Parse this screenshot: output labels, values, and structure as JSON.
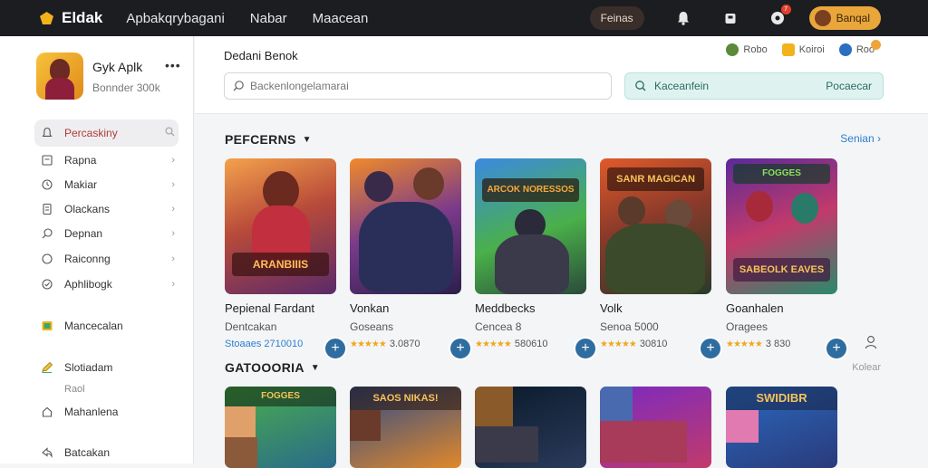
{
  "topbar": {
    "logo_text": "Eldak",
    "nav": [
      "Apbakqrybagani",
      "Nabar",
      "Maacean"
    ],
    "pill": "Feinas",
    "notif_count": "7",
    "user_label": "Banqal"
  },
  "sidebar": {
    "app_name": "Gyk Aplk",
    "app_sub": "Bonnder 300k",
    "items": [
      {
        "label": "Percaskiny"
      },
      {
        "label": "Rapna"
      },
      {
        "label": "Makiar"
      },
      {
        "label": "Olackans"
      },
      {
        "label": "Depnan"
      },
      {
        "label": "Raiconng"
      },
      {
        "label": "Aphlibogk"
      },
      {
        "label": "Mancecalan"
      },
      {
        "label": "Slotiadam"
      },
      {
        "label": "Mahanlena"
      },
      {
        "label": "Batcakan"
      }
    ],
    "sub_label": "Raol"
  },
  "header": {
    "title": "Dedani Benok",
    "badges": [
      "Robo",
      "Koiroi",
      "Roo"
    ],
    "search_placeholder": "Backenlongelamarai",
    "search2_left": "Kaceanfein",
    "search2_right": "Pocaecar"
  },
  "sections": {
    "featured_title": "PEFCERNS",
    "featured_link": "Senian",
    "category_title": "GATOOORIA",
    "category_link": "Kolear"
  },
  "cards": [
    {
      "name": "Pepienal Fardant",
      "sub": "Dentcakan",
      "rating": "Stoaaes 2710010",
      "stars": false
    },
    {
      "name": "Vonkan",
      "sub": "Goseans",
      "rating": "3.0870",
      "stars": true
    },
    {
      "name": "Meddbecks",
      "sub": "Cencea 8",
      "rating": "580610",
      "stars": true
    },
    {
      "name": "Volk",
      "sub": "Senoa 5000",
      "rating": "30810",
      "stars": true
    },
    {
      "name": "Goanhalen",
      "sub": "Oragees",
      "rating": "3 830",
      "stars": true
    }
  ],
  "art_text": [
    "ARANBIIIS",
    "ARCOK NORESSOS",
    "SANR MAGICAN",
    "SABEOLK EAVES",
    "FOGGES",
    "SAOS NIKAS!",
    "SWIDIBR"
  ],
  "colors": {
    "topbar_bg": "#1b1d21",
    "accent_orange": "#e9a63a",
    "link_blue": "#2a7fd0",
    "plus_button": "#2f6da0",
    "search2_bg": "#def3ef"
  }
}
